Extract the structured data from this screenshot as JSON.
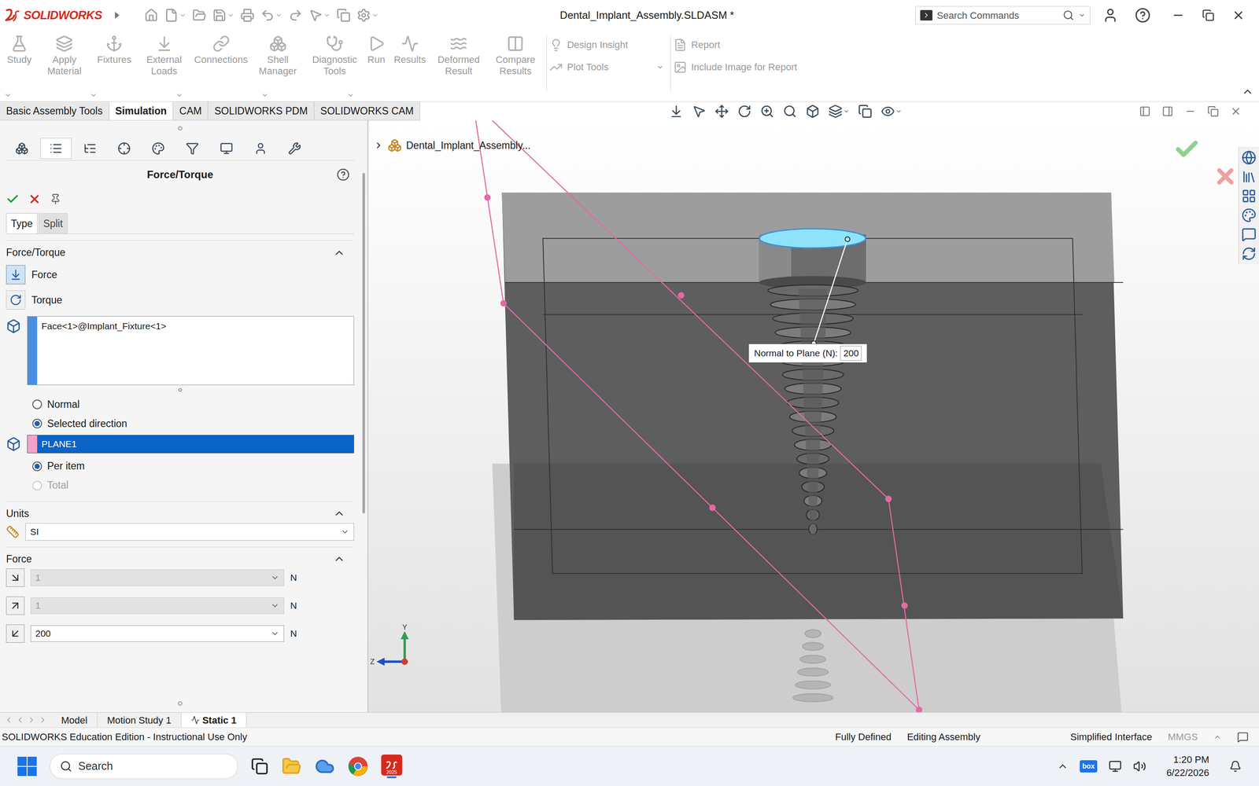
{
  "window": {
    "app": "SOLIDWORKS",
    "title": "Dental_Implant_Assembly.SLDASM *",
    "search_placeholder": "Search Commands"
  },
  "ribbon": {
    "buttons": [
      {
        "label": "Study",
        "disabled": true
      },
      {
        "label": "Apply Material",
        "disabled": true
      },
      {
        "label": "Fixtures",
        "disabled": true
      },
      {
        "label": "External Loads",
        "disabled": true
      },
      {
        "label": "Connections",
        "disabled": true
      },
      {
        "label": "Shell Manager",
        "disabled": true
      },
      {
        "label": "Diagnostic Tools",
        "disabled": true
      },
      {
        "label": "Run",
        "disabled": true
      },
      {
        "label": "Results",
        "disabled": true
      },
      {
        "label": "Deformed Result",
        "disabled": true
      },
      {
        "label": "Compare Results",
        "disabled": true
      }
    ],
    "stacked": [
      {
        "label": "Design Insight",
        "disabled": true
      },
      {
        "label": "Plot Tools",
        "disabled": true
      }
    ],
    "report": [
      {
        "label": "Report",
        "disabled": true
      },
      {
        "label": "Include Image for Report",
        "disabled": true
      }
    ]
  },
  "tabs": [
    {
      "label": "Basic Assembly Tools",
      "selected": false
    },
    {
      "label": "Simulation",
      "selected": true
    },
    {
      "label": "CAM",
      "selected": false
    },
    {
      "label": "SOLIDWORKS PDM",
      "selected": false
    },
    {
      "label": "SOLIDWORKS CAM",
      "selected": false
    }
  ],
  "panel": {
    "title": "Force/Torque",
    "subtabs": [
      {
        "label": "Type",
        "selected": true
      },
      {
        "label": "Split",
        "selected": false
      }
    ],
    "section_title": "Force/Torque",
    "modes": [
      {
        "label": "Force",
        "selected": true
      },
      {
        "label": "Torque",
        "selected": false
      }
    ],
    "faces": [
      "Face<1>@Implant_Fixture<1>"
    ],
    "direction_options": [
      {
        "label": "Normal",
        "selected": false,
        "disabled": false
      },
      {
        "label": "Selected direction",
        "selected": true,
        "disabled": false
      }
    ],
    "direction_ref": "PLANE1",
    "distribution_options": [
      {
        "label": "Per item",
        "selected": true,
        "disabled": false
      },
      {
        "label": "Total",
        "selected": false,
        "disabled": true
      }
    ],
    "units_title": "Units",
    "units": "SI",
    "force_title": "Force",
    "force_components": [
      {
        "value": "1",
        "unit": "N",
        "disabled": true
      },
      {
        "value": "1",
        "unit": "N",
        "disabled": true
      },
      {
        "value": "200",
        "unit": "N",
        "disabled": false
      }
    ]
  },
  "viewport": {
    "tree_root": "Dental_Implant_Assembly...",
    "callout": {
      "label": "Normal to Plane (N):",
      "value": "200"
    },
    "axes": {
      "y": "Y",
      "z": "Z"
    }
  },
  "bottom_tabs": [
    {
      "label": "Model",
      "selected": false
    },
    {
      "label": "Motion Study 1",
      "selected": false
    },
    {
      "label": "Static 1",
      "selected": true
    }
  ],
  "status_bar": {
    "left": "SOLIDWORKS Education Edition - Instructional Use Only",
    "items": [
      {
        "label": "Fully Defined",
        "disabled": false
      },
      {
        "label": "Editing Assembly",
        "disabled": false
      },
      {
        "label": "Simplified Interface",
        "disabled": false
      },
      {
        "label": "MMGS",
        "disabled": true
      }
    ]
  },
  "taskbar": {
    "search": "Search",
    "app_badge": "2025",
    "tray_app": "box",
    "time": "1:20 PM",
    "date": "6/22/2026"
  }
}
